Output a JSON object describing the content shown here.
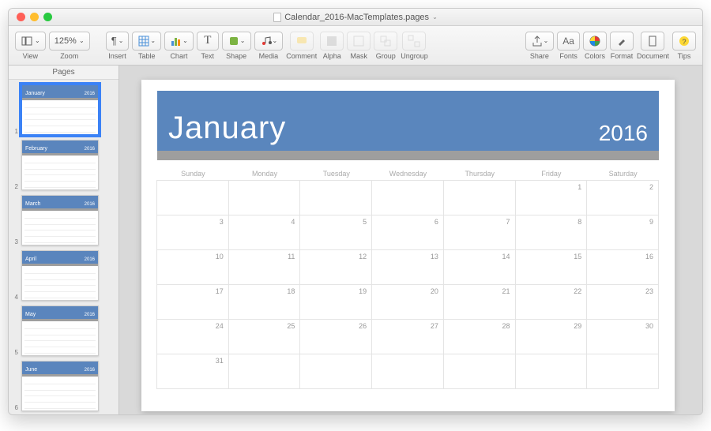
{
  "window": {
    "title": "Calendar_2016-MacTemplates.pages"
  },
  "toolbar": {
    "view_label": "View",
    "zoom_value": "125%",
    "zoom_label": "Zoom",
    "insert_label": "Insert",
    "table_label": "Table",
    "chart_label": "Chart",
    "text_label": "Text",
    "shape_label": "Shape",
    "media_label": "Media",
    "comment_label": "Comment",
    "alpha_label": "Alpha",
    "mask_label": "Mask",
    "group_label": "Group",
    "ungroup_label": "Ungroup",
    "share_label": "Share",
    "fonts_label": "Fonts",
    "colors_label": "Colors",
    "format_label": "Format",
    "document_label": "Document",
    "tips_label": "Tips"
  },
  "sidebar": {
    "header": "Pages",
    "thumbnails": [
      {
        "num": "1",
        "month": "January",
        "year": "2016",
        "selected": true
      },
      {
        "num": "2",
        "month": "February",
        "year": "2016",
        "selected": false
      },
      {
        "num": "3",
        "month": "March",
        "year": "2016",
        "selected": false
      },
      {
        "num": "4",
        "month": "April",
        "year": "2016",
        "selected": false
      },
      {
        "num": "5",
        "month": "May",
        "year": "2016",
        "selected": false
      },
      {
        "num": "6",
        "month": "June",
        "year": "2016",
        "selected": false
      }
    ]
  },
  "calendar": {
    "month": "January",
    "year": "2016",
    "day_names": [
      "Sunday",
      "Monday",
      "Tuesday",
      "Wednesday",
      "Thursday",
      "Friday",
      "Saturday"
    ],
    "weeks": [
      [
        "",
        "",
        "",
        "",
        "",
        "1",
        "2"
      ],
      [
        "3",
        "4",
        "5",
        "6",
        "7",
        "8",
        "9"
      ],
      [
        "10",
        "11",
        "12",
        "13",
        "14",
        "15",
        "16"
      ],
      [
        "17",
        "18",
        "19",
        "20",
        "21",
        "22",
        "23"
      ],
      [
        "24",
        "25",
        "26",
        "27",
        "28",
        "29",
        "30"
      ],
      [
        "31",
        "",
        "",
        "",
        "",
        "",
        ""
      ]
    ]
  },
  "colors": {
    "accent": "#5a86bd",
    "gray_bar": "#9e9e9e"
  }
}
